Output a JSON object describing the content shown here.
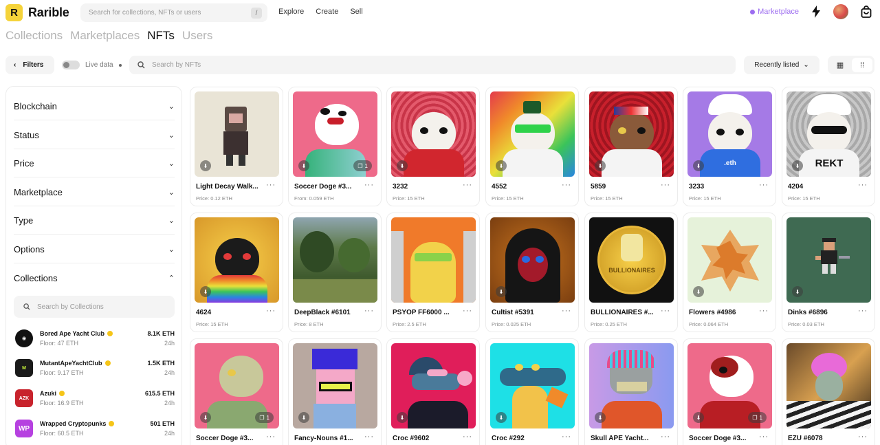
{
  "app": {
    "logo_letter": "R",
    "name": "Rarible"
  },
  "search": {
    "placeholder": "Search for collections, NFTs or users",
    "shortcut": "/"
  },
  "nav": {
    "links": [
      "Explore",
      "Create",
      "Sell"
    ],
    "marketplace_label": "Marketplace"
  },
  "tabs": [
    "Collections",
    "Marketplaces",
    "NFTs",
    "Users"
  ],
  "toolbar": {
    "filters_label": "Filters",
    "live_label": "Live data",
    "nft_search_placeholder": "Search by NFTs",
    "sort_label": "Recently listed"
  },
  "sidebar": {
    "facets": [
      "Blockchain",
      "Status",
      "Price",
      "Marketplace",
      "Type",
      "Options",
      "Collections"
    ],
    "collection_search_placeholder": "Search by Collections",
    "collections": [
      {
        "name": "Bored Ape Yacht Club",
        "floor": "Floor: 47 ETH",
        "volume": "8.1K ETH",
        "period": "24h"
      },
      {
        "name": "MutantApeYachtClub",
        "floor": "Floor: 9.17 ETH",
        "volume": "1.5K ETH",
        "period": "24h"
      },
      {
        "name": "Azuki",
        "floor": "Floor: 16.9 ETH",
        "volume": "615.5 ETH",
        "period": "24h"
      },
      {
        "name": "Wrapped Cryptopunks",
        "floor": "Floor: 60.5 ETH",
        "volume": "501 ETH",
        "period": "24h"
      }
    ]
  },
  "nfts": [
    {
      "title": "Light Decay Walk...",
      "price": "Price: 0.12 ETH"
    },
    {
      "title": "Soccer Doge #3...",
      "price": "From: 0.059 ETH",
      "count": "1"
    },
    {
      "title": "3232",
      "price": "Price: 15 ETH"
    },
    {
      "title": "4552",
      "price": "Price: 15 ETH"
    },
    {
      "title": "5859",
      "price": "Price: 15 ETH"
    },
    {
      "title": "3233",
      "price": "Price: 15 ETH"
    },
    {
      "title": "4204",
      "price": "Price: 15 ETH"
    },
    {
      "title": "4624",
      "price": "Price: 15 ETH"
    },
    {
      "title": "DeepBlack #6101",
      "price": "Price: 8 ETH"
    },
    {
      "title": "PSYOP FF6000 ...",
      "price": "Price: 2.5 ETH"
    },
    {
      "title": "Cultist #5391",
      "price": "Price: 0.025 ETH"
    },
    {
      "title": "BULLIONAIRES #...",
      "price": "Price: 0.25 ETH"
    },
    {
      "title": "Flowers #4986",
      "price": "Price: 0.064 ETH"
    },
    {
      "title": "Dinks #6896",
      "price": "Price: 0.03 ETH"
    },
    {
      "title": "Soccer Doge #3...",
      "price": "",
      "count": "1"
    },
    {
      "title": "Fancy-Nouns #1...",
      "price": ""
    },
    {
      "title": "Croc #9602",
      "price": ""
    },
    {
      "title": "Croc #292",
      "price": ""
    },
    {
      "title": "Skull APE Yacht...",
      "price": ""
    },
    {
      "title": "Soccer Doge #3...",
      "price": "",
      "count": "1"
    },
    {
      "title": "EZU #6078",
      "price": ""
    }
  ],
  "art": {
    "REKT": "REKT",
    "eth": ".eth",
    "bullionaires": "BULLIONAIRES"
  },
  "colors": {
    "accent": "#f5d33a",
    "marketplace": "#9c6cf0"
  }
}
